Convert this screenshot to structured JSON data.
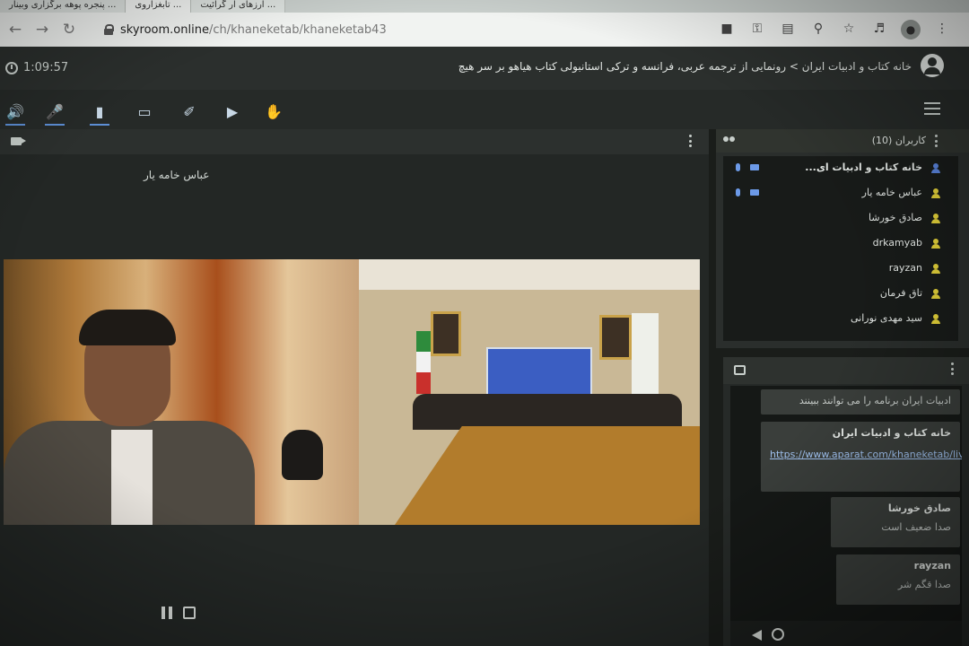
{
  "browser": {
    "tabs": [
      {
        "label": "... پنجره پوهه برگزاری وبینار"
      },
      {
        "label": "... تابغزاروی"
      },
      {
        "label": "... ارزهای ار گرائیت"
      }
    ],
    "url_host": "skyroom.online",
    "url_path": "/ch/khaneketab/khaneketab43",
    "icons": [
      "camera-icon",
      "key-icon",
      "translate-icon",
      "zoom-icon",
      "star-icon",
      "playlist-icon",
      "profile-icon",
      "more-icon"
    ]
  },
  "header": {
    "timer": "1:09:57",
    "title": "خانه کتاب و ادبیات ایران > رونمایی از ترجمه عربی، فرانسه و ترکی استانبولی کتاب هیاهو بر سر هیچ"
  },
  "toolbar": {
    "tools": [
      "speaker-icon",
      "mic-icon",
      "camera-icon",
      "screen-share-icon",
      "brush-icon",
      "play-media-icon",
      "raise-hand-icon"
    ]
  },
  "video": {
    "speaker_name": "عباس خامه یار"
  },
  "users_panel": {
    "title": "کاربران (10)",
    "users": [
      {
        "name": "خانه کتاب و ادبیات ای...",
        "host": true
      },
      {
        "name": "عباس خامه یار",
        "host": false
      },
      {
        "name": "صادق خورشا",
        "host": false
      },
      {
        "name": "drkamyab",
        "host": false
      },
      {
        "name": "rayzan",
        "host": false
      },
      {
        "name": "تاق فرمان",
        "host": false
      },
      {
        "name": "سید مهدی نورانی",
        "host": false
      }
    ]
  },
  "chat": {
    "messages": [
      {
        "sender": "",
        "text": "ادبیات ایران برنامه را می توانند ببینند"
      },
      {
        "sender": "خانه کتاب و ادبیات ایران",
        "link": "https://www.aparat.com/khaneketab/live"
      },
      {
        "sender": "صادق خورشا",
        "text": "صدا ضعیف است"
      },
      {
        "sender": "rayzan",
        "text": "صدا قگم شر"
      }
    ]
  },
  "colors": {
    "accent": "#5d8fd6",
    "user_icon": "#e6d43a",
    "host_icon": "#5b86e0",
    "header_bg": "#2b2f2d"
  }
}
